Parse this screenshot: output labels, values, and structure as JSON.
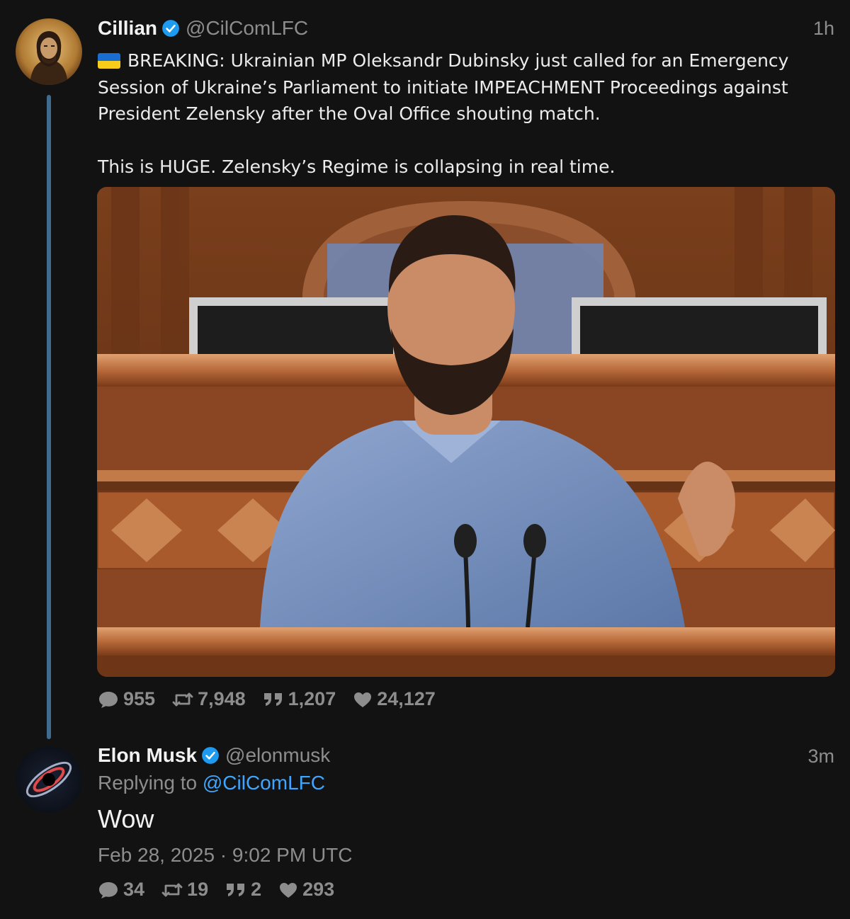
{
  "main_tweet": {
    "name": "Cillian",
    "handle": "@CilComLFC",
    "time": "1h",
    "text_line1": "BREAKING: Ukrainian MP Oleksandr Dubinsky just called for an Emergency Session of Ukraine’s Parliament to initiate IMPEACHMENT Proceedings against President Zelensky after the Oval Office shouting match.",
    "text_line2": "This is HUGE. Zelensky’s Regime is collapsing in real time.",
    "stats": {
      "replies": "955",
      "retweets": "7,948",
      "quotes": "1,207",
      "likes": "24,127"
    }
  },
  "reply_tweet": {
    "name": "Elon Musk",
    "handle": "@elonmusk",
    "time": "3m",
    "replying_label": "Replying to",
    "replying_to": "@CilComLFC",
    "text": "Wow",
    "date": "Feb 28, 2025 · 9:02 PM UTC",
    "stats": {
      "replies": "34",
      "retweets": "19",
      "quotes": "2",
      "likes": "293"
    }
  },
  "colors": {
    "background": "#121212",
    "thread_line": "#3f6b8f",
    "verified": "#1d9bf0",
    "link": "#3ea6ff",
    "muted": "#8d8d8d"
  },
  "icons": [
    "verified-badge-icon",
    "reply-icon",
    "retweet-icon",
    "quote-icon",
    "heart-icon",
    "ukraine-flag-icon"
  ]
}
